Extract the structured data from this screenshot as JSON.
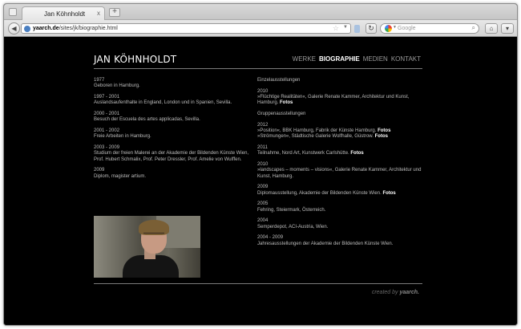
{
  "browser": {
    "tab_title": "Jan Köhnholdt",
    "tab_close": "x",
    "new_tab": "+",
    "url_host": "yaarch.de",
    "url_path": "/sites/jk/biographie.html",
    "search_placeholder": "Google"
  },
  "site": {
    "title": "JAN KÖHNHOLDT",
    "nav": [
      "WERKE",
      "BIOGRAPHIE",
      "MEDIEN",
      "KONTAKT"
    ],
    "active_nav": "BIOGRAPHIE",
    "footer_prefix": "created by",
    "footer_brand": "yaarch."
  },
  "bio": [
    {
      "year": "1977",
      "text": "Geboren in Hamburg."
    },
    {
      "year": "1997 - 2001",
      "text": "Auslandsaufenthalte in England, London und in Spanien, Sevilla."
    },
    {
      "year": "2000 - 2001",
      "text": "Besuch der Escuela des artes applicadas, Sevilla."
    },
    {
      "year": "2001 - 2002",
      "text": "Freie Arbeiten in Hamburg."
    },
    {
      "year": "2003 - 2009",
      "text": "Studium der freien Malerei an der Akademie der Bildenden Künste Wien, Prof. Hubert Schmalix, Prof. Peter Dressler, Prof. Amelie von Wulffen."
    },
    {
      "year": "2009",
      "text": "Diplom, magister artium."
    }
  ],
  "exhibitions": {
    "solo_heading": "Einzelausstellungen",
    "solo": [
      {
        "year": "2010",
        "text": "»Flüchtige Realitäten«, Galerie Renate Kammer, Architektur und Kunst, Hamburg.",
        "link": "Fotos"
      }
    ],
    "group_heading": "Gruppenausstellungen",
    "group": [
      {
        "year": "2012",
        "lines": [
          {
            "text": "»Position«, BBK Hamburg, Fabrik der Künste Hamburg.",
            "link": "Fotos"
          },
          {
            "text": "»Strömungen«, Städtische Galerie Wolfhalle, Güstrow.",
            "link": "Fotos"
          }
        ]
      },
      {
        "year": "2011",
        "lines": [
          {
            "text": "Teilnahme, Nord Art, Kunstwerk Carlshütte.",
            "link": "Fotos"
          }
        ]
      },
      {
        "year": "2010",
        "lines": [
          {
            "text": "»landscapes – moments – visions«, Galerie Renate Kammer, Architektur und Kunst, Hamburg.",
            "link": ""
          }
        ]
      },
      {
        "year": "2009",
        "lines": [
          {
            "text": "Diplomausstellung, Akademie der Bildenden Künste Wien.",
            "link": "Fotos"
          }
        ]
      },
      {
        "year": "2005",
        "lines": [
          {
            "text": "Fehring, Steiermark, Österreich.",
            "link": ""
          }
        ]
      },
      {
        "year": "2004",
        "lines": [
          {
            "text": "Semperdepot, ACI-Austria, Wien.",
            "link": ""
          }
        ]
      },
      {
        "year": "2004 - 2009",
        "lines": [
          {
            "text": "Jahresausstellungen der Akademie der Bildenden Künste Wien.",
            "link": ""
          }
        ]
      }
    ]
  }
}
